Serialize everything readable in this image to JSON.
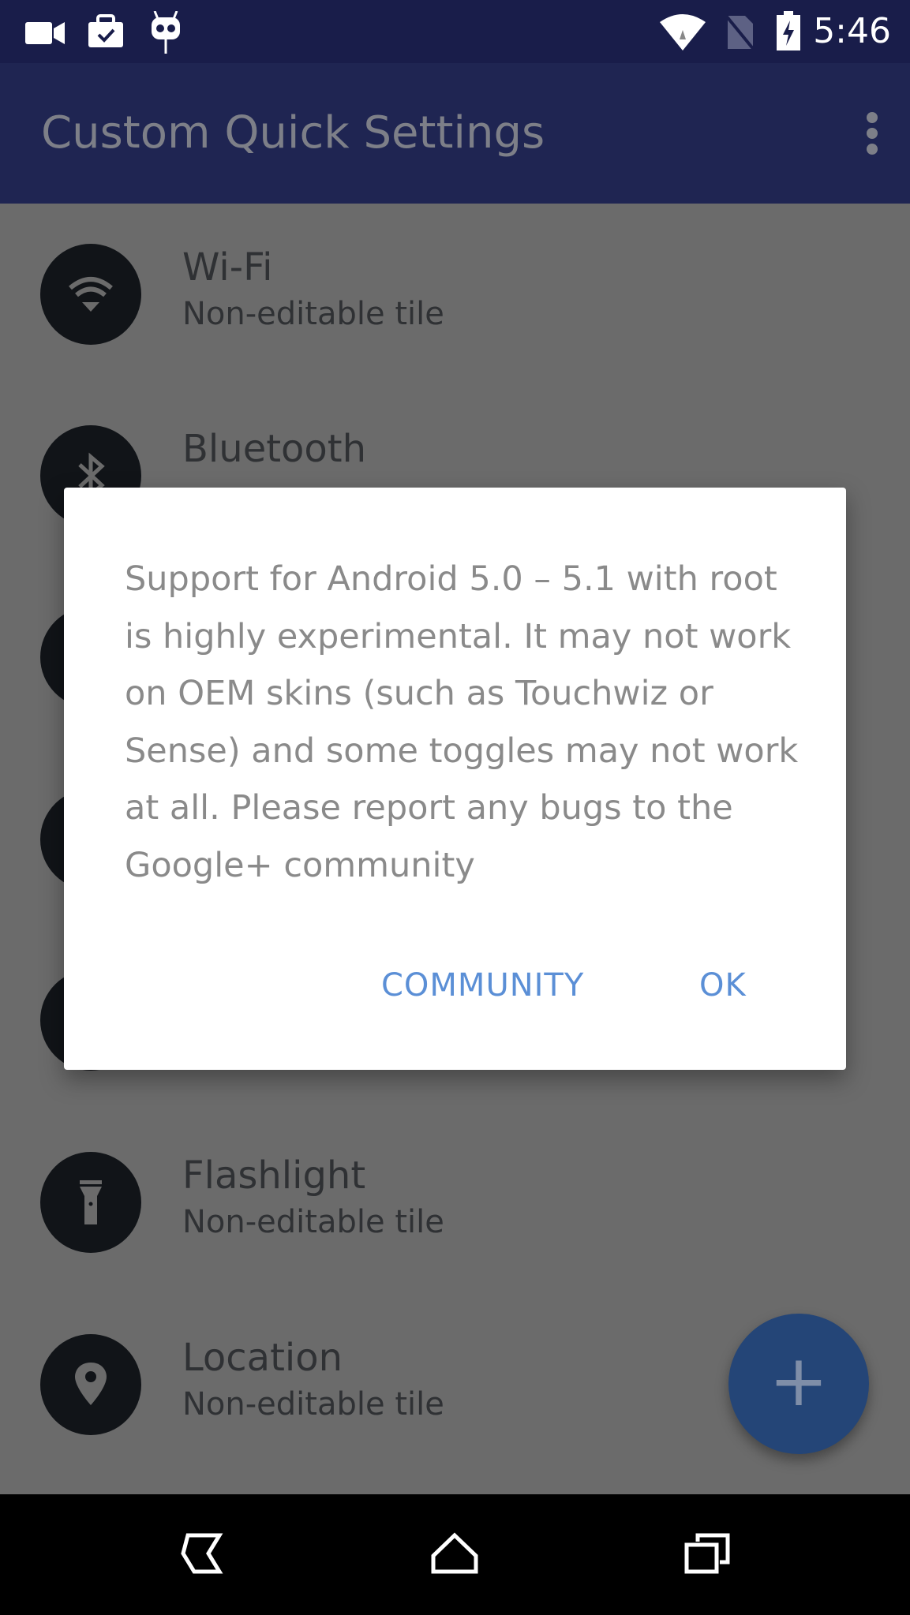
{
  "status_bar": {
    "time": "5:46",
    "icons": [
      "video-camera-icon",
      "work-briefcase-icon",
      "cyanogenmod-icon",
      "wifi-icon",
      "no-sim-icon",
      "battery-charging-icon"
    ]
  },
  "app_bar": {
    "title": "Custom Quick Settings",
    "menu_icon": "more-vert-icon"
  },
  "list": {
    "items": [
      {
        "title": "Wi-Fi",
        "subtitle": "Non-editable tile",
        "icon": "wifi-icon"
      },
      {
        "title": "Bluetooth",
        "subtitle": "",
        "icon": "bluetooth-icon"
      },
      {
        "title": "",
        "subtitle": "",
        "icon": ""
      },
      {
        "title": "",
        "subtitle": "",
        "icon": ""
      },
      {
        "title": "",
        "subtitle": "",
        "icon": ""
      },
      {
        "title": "Flashlight",
        "subtitle": "Non-editable tile",
        "icon": "flashlight-icon"
      },
      {
        "title": "Location",
        "subtitle": "Non-editable tile",
        "icon": "location-icon"
      }
    ]
  },
  "dialog": {
    "message": "Support for Android 5.0 – 5.1 with root is highly experimental. It may not work on OEM skins (such as Touchwiz or Sense) and some toggles may not work at all. Please report any bugs to the Google+ community",
    "community_label": "COMMUNITY",
    "ok_label": "OK"
  },
  "fab": {
    "label": "+"
  },
  "colors": {
    "status_bar": "#191d4a",
    "app_bar": "#1f2552",
    "accent": "#5b8fd6",
    "fab": "#244577",
    "scrim_bg": "#6b6b6b"
  }
}
